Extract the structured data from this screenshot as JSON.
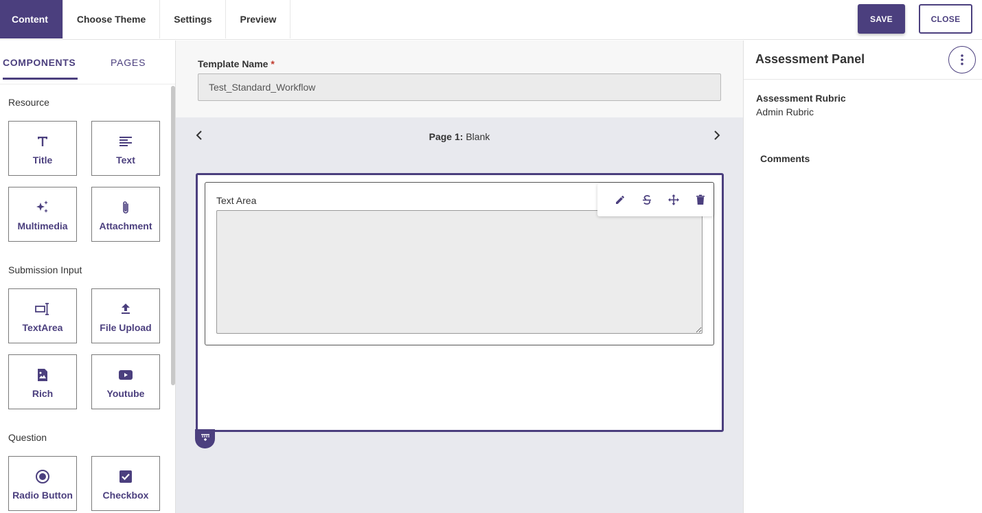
{
  "topbar": {
    "tabs": [
      {
        "label": "Content"
      },
      {
        "label": "Choose Theme"
      },
      {
        "label": "Settings"
      },
      {
        "label": "Preview"
      }
    ],
    "save_label": "SAVE",
    "close_label": "CLOSE"
  },
  "sidebar": {
    "tabs": {
      "components": "COMPONENTS",
      "pages": "PAGES"
    },
    "sections": {
      "resource": "Resource",
      "submission": "Submission Input",
      "question": "Question"
    },
    "cards": {
      "title": "Title",
      "text": "Text",
      "multimedia": "Multimedia",
      "attachment": "Attachment",
      "textarea": "TextArea",
      "fileupload": "File Upload",
      "rich": "Rich",
      "youtube": "Youtube",
      "radio": "Radio Button",
      "checkbox": "Checkbox"
    }
  },
  "main": {
    "template_label": "Template Name",
    "required_mark": "*",
    "template_value": "Test_Standard_Workflow",
    "page_prefix": "Page 1:",
    "page_name": "Blank",
    "component_label": "Text Area"
  },
  "panel": {
    "title": "Assessment Panel",
    "rubric_label": "Assessment Rubric",
    "rubric_value": "Admin Rubric",
    "comments_label": "Comments"
  },
  "colors": {
    "accent": "#4b3f7e"
  }
}
